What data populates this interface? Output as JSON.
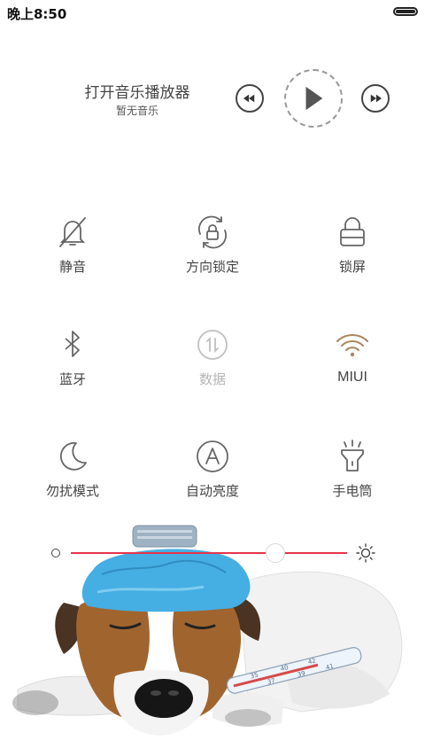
{
  "status_bar": {
    "time": "晚上8:50"
  },
  "music": {
    "title": "打开音乐播放器",
    "subtitle": "暂无音乐",
    "prev_icon": "rewind-icon",
    "play_icon": "play-icon",
    "next_icon": "fast-forward-icon"
  },
  "toggles": [
    {
      "label": "静音",
      "icon": "bell-off-icon",
      "enabled": true
    },
    {
      "label": "方向锁定",
      "icon": "rotation-lock-icon",
      "enabled": true
    },
    {
      "label": "锁屏",
      "icon": "lock-icon",
      "enabled": true
    },
    {
      "label": "蓝牙",
      "icon": "bluetooth-icon",
      "enabled": true
    },
    {
      "label": "数据",
      "icon": "mobile-data-icon",
      "enabled": false
    },
    {
      "label": "MIUI",
      "icon": "wifi-icon",
      "enabled": true,
      "active": true
    },
    {
      "label": "勿扰模式",
      "icon": "moon-icon",
      "enabled": true
    },
    {
      "label": "自动亮度",
      "icon": "auto-brightness-icon",
      "enabled": true
    },
    {
      "label": "手电筒",
      "icon": "flashlight-icon",
      "enabled": true
    }
  ],
  "brightness": {
    "level": 0.74
  },
  "colors": {
    "accent": "#e8344a",
    "wifi_active": "#a8865e",
    "ice_bag": "#45aee3"
  },
  "thermometer": {
    "scale_numbers": [
      "35",
      "40",
      "42",
      "37",
      "39",
      "41"
    ]
  }
}
